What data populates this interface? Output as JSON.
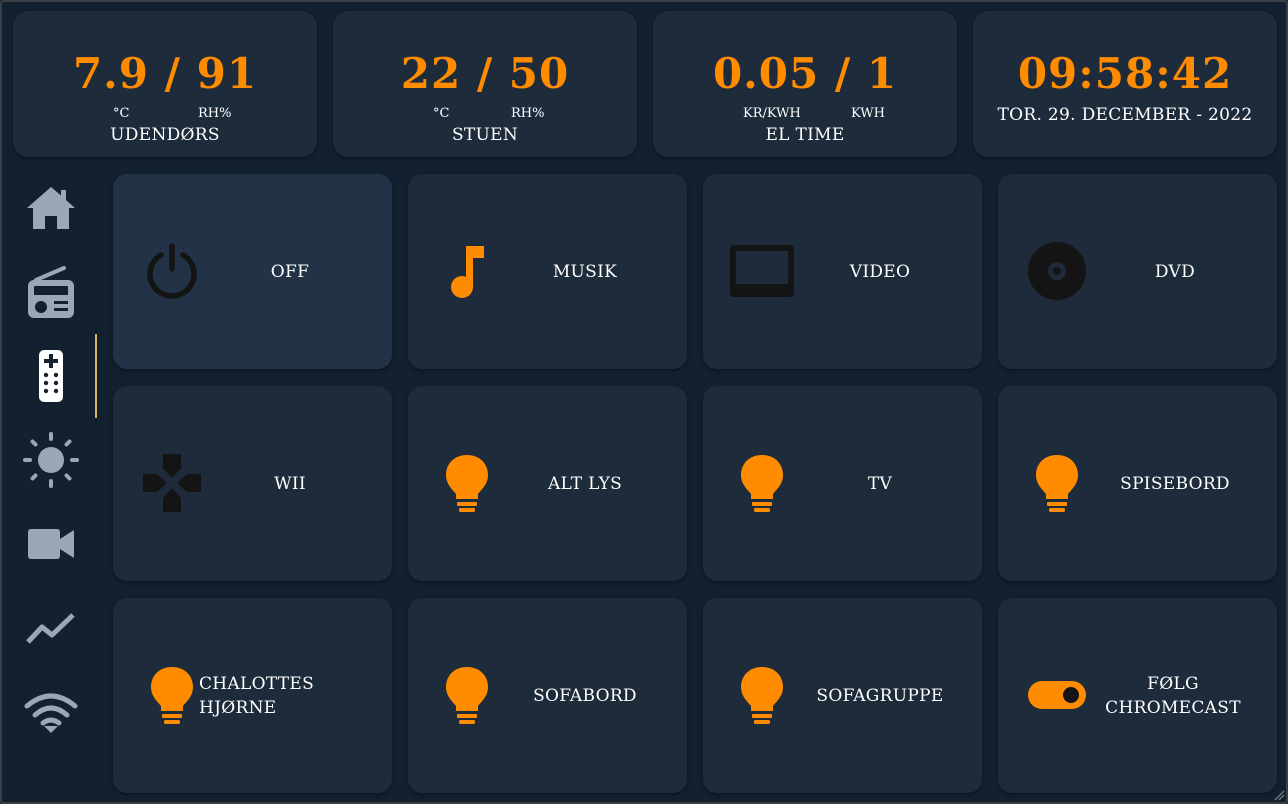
{
  "colors": {
    "accent": "#ff8c00",
    "card": "#1e2b3b",
    "background": "#13202f",
    "nav_icon": "#9aa7b5",
    "tile_icon_dark": "#141414",
    "active_indicator": "#d4b35c"
  },
  "sensors": [
    {
      "value": "7.9 / 91",
      "unit_left": "°C",
      "unit_right": "RH%",
      "label": "UDENDØRS"
    },
    {
      "value": "22 / 50",
      "unit_left": "°C",
      "unit_right": "RH%",
      "label": "STUEN"
    },
    {
      "value": "0.05 / 1",
      "unit_left": "KR/KWH",
      "unit_right": "KWH",
      "label": "EL TIME"
    }
  ],
  "clock": {
    "time": "09:58:42",
    "date": "TOR. 29. DECEMBER - 2022"
  },
  "nav": [
    {
      "icon": "home-icon"
    },
    {
      "icon": "radio-icon"
    },
    {
      "icon": "remote-icon",
      "active": true
    },
    {
      "icon": "sun-icon"
    },
    {
      "icon": "video-camera-icon"
    },
    {
      "icon": "chart-line-icon"
    },
    {
      "icon": "wifi-icon"
    }
  ],
  "tiles": [
    {
      "label": "OFF",
      "icon": "power-icon"
    },
    {
      "label": "MUSIK",
      "icon": "music-note-icon"
    },
    {
      "label": "VIDEO",
      "icon": "tv-icon"
    },
    {
      "label": "DVD",
      "icon": "disc-icon"
    },
    {
      "label": "WII",
      "icon": "gamepad-icon"
    },
    {
      "label": "ALT LYS",
      "icon": "lightbulb-icon"
    },
    {
      "label": "TV",
      "icon": "lightbulb-icon"
    },
    {
      "label": "SPISEBORD",
      "icon": "lightbulb-icon"
    },
    {
      "label": "CHALOTTES HJØRNE",
      "icon": "lightbulb-icon"
    },
    {
      "label": "SOFABORD",
      "icon": "lightbulb-icon"
    },
    {
      "label": "SOFAGRUPPE",
      "icon": "lightbulb-icon"
    },
    {
      "label": "FØLG CHROMECAST",
      "icon": "toggle-icon"
    }
  ]
}
